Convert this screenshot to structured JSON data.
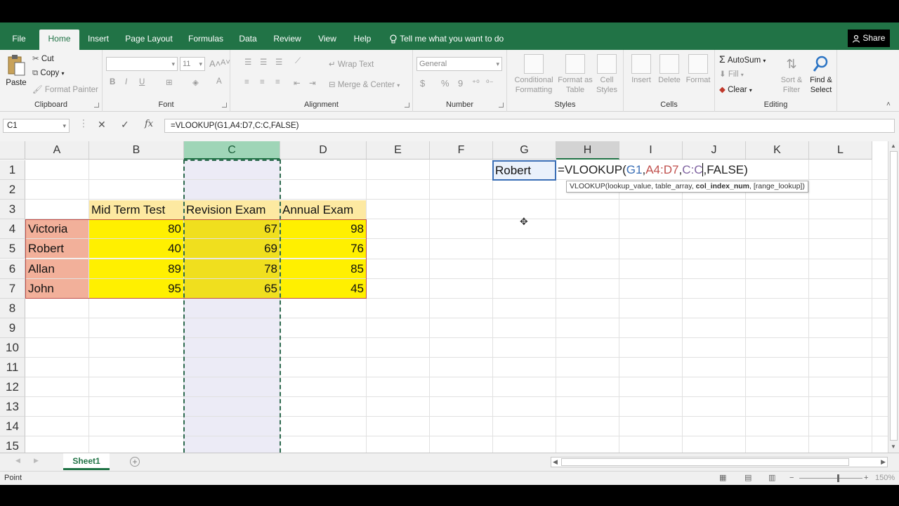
{
  "tabs": [
    "File",
    "Home",
    "Insert",
    "Page Layout",
    "Formulas",
    "Data",
    "Review",
    "View",
    "Help"
  ],
  "active_tab": "Home",
  "tell_me": "Tell me what you want to do",
  "share": "Share",
  "ribbon": {
    "clipboard": {
      "label": "Clipboard",
      "paste": "Paste",
      "cut": "Cut",
      "copy": "Copy",
      "format_painter": "Format Painter"
    },
    "font": {
      "label": "Font",
      "font_name": "",
      "font_size": "11",
      "bold": "B",
      "italic": "I",
      "underline": "U"
    },
    "alignment": {
      "label": "Alignment",
      "wrap_text": "Wrap Text",
      "merge_center": "Merge & Center"
    },
    "number": {
      "label": "Number",
      "format": "General",
      "currency": "$",
      "percent": "%",
      "comma": "9"
    },
    "styles": {
      "label": "Styles",
      "conditional": [
        "Conditional",
        "Formatting"
      ],
      "format_table": [
        "Format as",
        "Table"
      ],
      "cell_styles": [
        "Cell",
        "Styles"
      ]
    },
    "cells": {
      "label": "Cells",
      "insert": "Insert",
      "delete": "Delete",
      "format": "Format"
    },
    "editing": {
      "label": "Editing",
      "autosum": "AutoSum",
      "fill": "Fill",
      "clear": "Clear",
      "sort_filter": [
        "Sort &",
        "Filter"
      ],
      "find_select": [
        "Find &",
        "Select"
      ]
    }
  },
  "formula_bar": {
    "name_box": "C1",
    "formula": "=VLOOKUP(G1,A4:D7,C:C,FALSE)"
  },
  "columns": [
    "A",
    "B",
    "C",
    "D",
    "E",
    "F",
    "G",
    "H",
    "I",
    "J",
    "K",
    "L"
  ],
  "rows": [
    "1",
    "2",
    "3",
    "4",
    "5",
    "6",
    "7",
    "8",
    "9",
    "10",
    "11",
    "12",
    "13",
    "14",
    "15"
  ],
  "table": {
    "headers": [
      "Mid Term Test",
      "Revision Exam",
      "Annual Exam"
    ],
    "rows": [
      {
        "name": "Victoria",
        "values": [
          "80",
          "67",
          "98"
        ]
      },
      {
        "name": "Robert",
        "values": [
          "40",
          "69",
          "76"
        ]
      },
      {
        "name": "Allan",
        "values": [
          "89",
          "78",
          "85"
        ]
      },
      {
        "name": "John",
        "values": [
          "95",
          "65",
          "45"
        ]
      }
    ]
  },
  "lookup_cell": "Robert",
  "editing_formula": {
    "prefix": "=VLOOKUP(",
    "arg1": "G1",
    "sep1": ",",
    "arg2": "A4:D7",
    "sep2": ",",
    "arg3": "C:C",
    "suffix": ",FALSE)"
  },
  "tooltip": {
    "pre": "VLOOKUP(lookup_value, table_array, ",
    "bold": "col_index_num",
    "post": ", [range_lookup])"
  },
  "colors": {
    "green": "#217346",
    "arg1": "#3b6fb6",
    "arg2": "#c0504d",
    "arg3": "#8064a2"
  },
  "sheet_tab": "Sheet1",
  "status": "Point",
  "zoom": "150%"
}
